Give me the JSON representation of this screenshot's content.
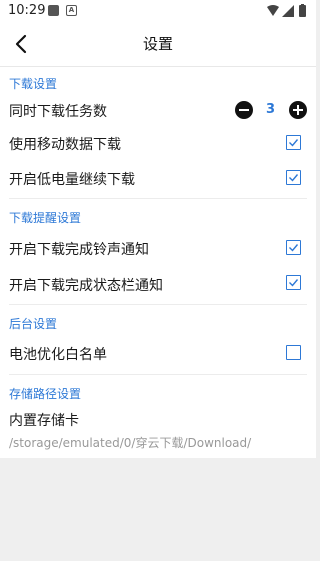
{
  "status_bar": {
    "time": "10:29",
    "icon_a_text": "A"
  },
  "header": {
    "title": "设置"
  },
  "sections": {
    "download": {
      "title": "下载设置",
      "concurrent_tasks_label": "同时下载任务数",
      "concurrent_tasks_value": "3",
      "mobile_data_label": "使用移动数据下载",
      "mobile_data_checked": true,
      "low_battery_label": "开启低电量继续下载",
      "low_battery_checked": true
    },
    "reminder": {
      "title": "下载提醒设置",
      "ringtone_label": "开启下载完成铃声通知",
      "ringtone_checked": true,
      "statusbar_label": "开启下载完成状态栏通知",
      "statusbar_checked": true
    },
    "background": {
      "title": "后台设置",
      "battery_whitelist_label": "电池优化白名单",
      "battery_whitelist_checked": false
    },
    "storage": {
      "title": "存储路径设置",
      "location_label": "内置存储卡",
      "path": "/storage/emulated/0/穿云下载/Download/"
    }
  },
  "colors": {
    "accent": "#2d78d6",
    "page_bg": "#efefef",
    "card_bg": "#ffffff"
  }
}
